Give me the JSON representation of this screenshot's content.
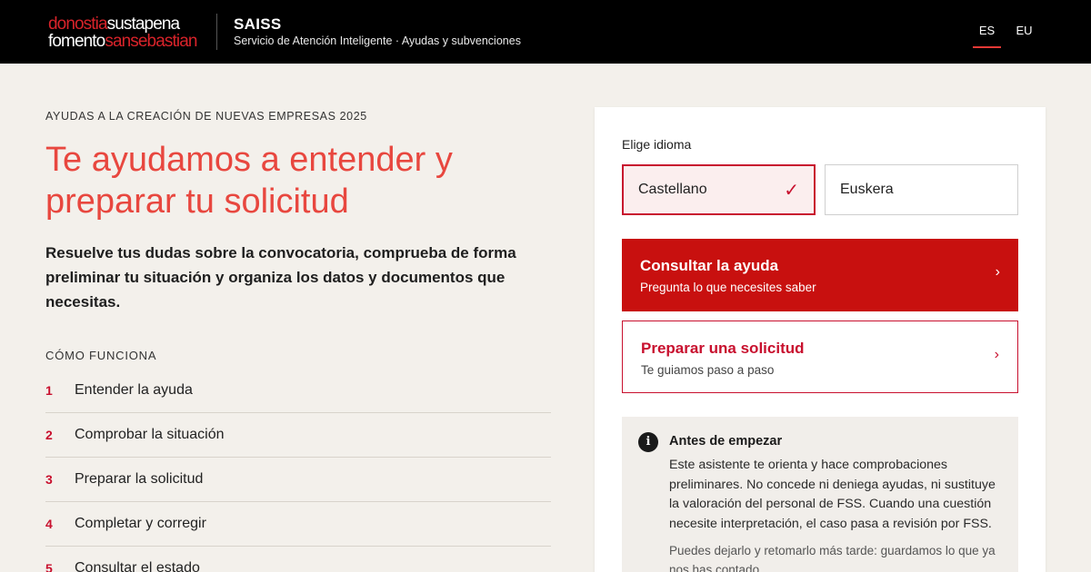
{
  "header": {
    "logo": {
      "line1_red": "donostia",
      "line1_white": "sustapena",
      "line2_white": "fomento",
      "line2_red": "sansebastian"
    },
    "brand": "SAISS",
    "subtitle": "Servicio de Atención Inteligente · Ayudas y subvenciones",
    "languages": [
      {
        "code": "ES",
        "active": true
      },
      {
        "code": "EU",
        "active": false
      }
    ]
  },
  "hero": {
    "eyebrow": "AYUDAS A LA CREACIÓN DE NUEVAS EMPRESAS 2025",
    "title": "Te ayudamos a entender y preparar tu solicitud",
    "description": "Resuelve tus dudas sobre la convocatoria, comprueba de forma preliminar tu situación y organiza los datos y documentos que necesitas."
  },
  "how_it_works": {
    "title": "CÓMO FUNCIONA",
    "steps": [
      {
        "num": "1",
        "label": "Entender la ayuda"
      },
      {
        "num": "2",
        "label": "Comprobar la situación"
      },
      {
        "num": "3",
        "label": "Preparar la solicitud"
      },
      {
        "num": "4",
        "label": "Completar y corregir"
      },
      {
        "num": "5",
        "label": "Consultar el estado"
      }
    ]
  },
  "panel": {
    "language_label": "Elige idioma",
    "language_options": [
      {
        "label": "Castellano",
        "selected": true
      },
      {
        "label": "Euskera",
        "selected": false
      }
    ],
    "actions": [
      {
        "title": "Consultar la ayuda",
        "subtitle": "Pregunta lo que necesites saber",
        "chevron": "›"
      },
      {
        "title": "Preparar una solicitud",
        "subtitle": "Te guiamos paso a paso",
        "chevron": "›"
      }
    ],
    "notice": {
      "icon": "i",
      "title": "Antes de empezar",
      "body": "Este asistente te orienta y hace comprobaciones preliminares. No concede ni deniega ayudas, ni sustituye la valoración del personal de FSS. Cuando una cuestión necesite interpretación, el caso pasa a revisión por FSS.",
      "note": "Puedes dejarlo y retomarlo más tarde: guardamos lo que ya nos has contado."
    }
  },
  "colors": {
    "accent": "#c8100f",
    "title_red": "#e8473f",
    "header_bg": "#000000",
    "page_bg": "#f3f0eb"
  }
}
